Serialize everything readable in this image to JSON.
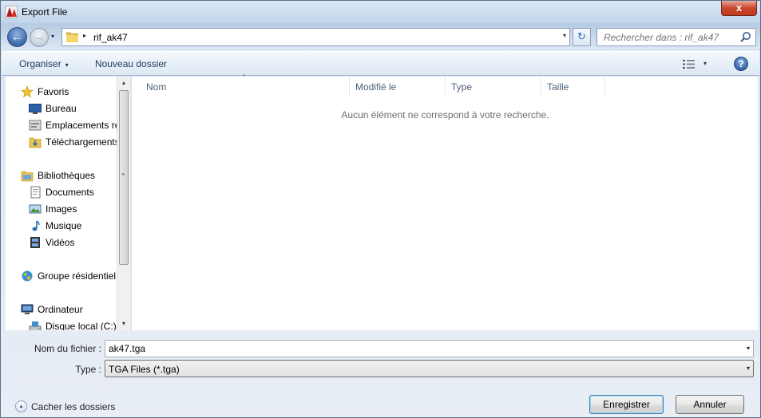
{
  "window": {
    "title": "Export File",
    "close_label": "x"
  },
  "address": {
    "crumb_separator": "▸",
    "current_folder": "rif_ak47",
    "dropdown_glyph": "▾",
    "back_glyph": "←",
    "forward_glyph": "→",
    "history_glyph": "▾",
    "refresh_glyph": "↻"
  },
  "search": {
    "placeholder": "Rechercher dans : rif_ak47"
  },
  "toolbar": {
    "organize_label": "Organiser",
    "organize_caret": "▾",
    "new_folder_label": "Nouveau dossier",
    "view_caret": "▾",
    "help_label": "?"
  },
  "sidebar": {
    "items": [
      {
        "label": "Favoris",
        "icon": "star-icon"
      },
      {
        "label": "Bureau",
        "icon": "desktop-icon"
      },
      {
        "label": "Emplacements ré",
        "icon": "recent-places-icon"
      },
      {
        "label": "Téléchargements",
        "icon": "downloads-folder-icon"
      },
      {
        "label": "Bibliothèques",
        "icon": "libraries-icon"
      },
      {
        "label": "Documents",
        "icon": "documents-icon"
      },
      {
        "label": "Images",
        "icon": "pictures-icon"
      },
      {
        "label": "Musique",
        "icon": "music-icon"
      },
      {
        "label": "Vidéos",
        "icon": "videos-icon"
      },
      {
        "label": "Groupe résidentiel",
        "icon": "homegroup-icon"
      },
      {
        "label": "Ordinateur",
        "icon": "computer-icon"
      },
      {
        "label": "Disque local (C:)",
        "icon": "drive-icon"
      }
    ],
    "scroll_up": "▴",
    "scroll_down": "▾"
  },
  "file_list": {
    "columns": [
      "Nom",
      "Modifié le",
      "Type",
      "Taille"
    ],
    "sort_caret": "^",
    "empty_message": "Aucun élément ne correspond à votre recherche."
  },
  "form": {
    "filename_label": "Nom du fichier :",
    "filename_value": "ak47.tga",
    "type_label": "Type :",
    "type_value": "TGA Files (*.tga)",
    "dropdown_glyph": "▾"
  },
  "footer": {
    "hide_folders_label": "Cacher les dossiers",
    "hide_folders_glyph": "▴",
    "save_label": "Enregistrer",
    "cancel_label": "Annuler"
  },
  "colors": {
    "accent": "#3a68a8",
    "close": "#c8472f"
  }
}
